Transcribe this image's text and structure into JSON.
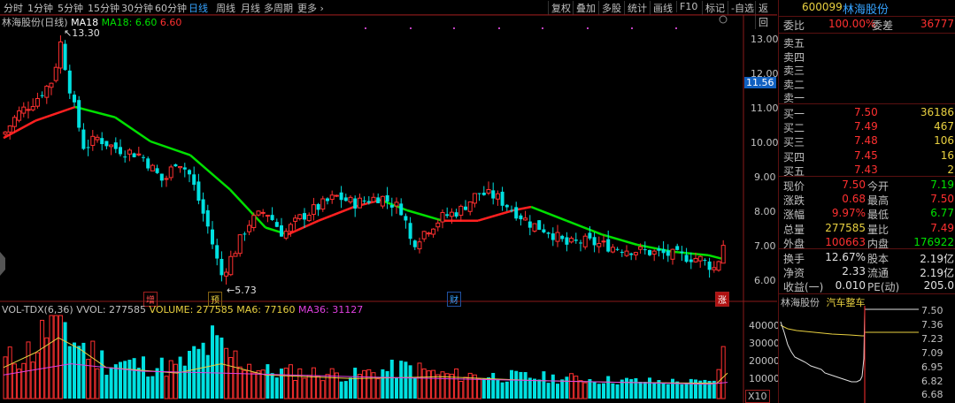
{
  "toolbar": {
    "periods": [
      "分时",
      "1分钟",
      "5分钟",
      "15分钟",
      "30分钟",
      "60分钟",
      "日线",
      "周线",
      "月线",
      "多周期",
      "更多"
    ],
    "active": "日线",
    "right": [
      "复权",
      "叠加",
      "多股",
      "统计",
      "画线",
      "F10",
      "标记",
      "-自选",
      "返回"
    ]
  },
  "chart_header": {
    "title": "林海股份(日线)",
    "ma": "MA18",
    "ma18_label": "MA18: 6.60",
    "ma18_value": "6.60"
  },
  "price_axis": [
    "13.00",
    "12.00",
    "11.00",
    "10.00",
    "9.00",
    "8.00",
    "7.00",
    "6.00"
  ],
  "current_price_tag": "11.56",
  "annotations": {
    "high": "13.30",
    "low": "5.73",
    "tag_zeng": "增",
    "tag_jiu": "预",
    "tag_cai": "财",
    "tag_zhang": "涨"
  },
  "volume_header": {
    "name": "VOL-TDX(6,36)",
    "vvol": "VVOL: 277585",
    "volume": "VOLUME: 277585",
    "ma6": "MA6: 77160",
    "ma36": "MA36: 31127"
  },
  "volume_axis": [
    "40000",
    "30000",
    "20000",
    "10000"
  ],
  "volume_unit": "X10",
  "quote": {
    "code": "600099",
    "name": "林海股份",
    "weibi_label": "委比",
    "weibi": "100.00%",
    "weicha_label": "委差",
    "weicha": "36777",
    "sell": [
      {
        "label": "卖五",
        "price": "",
        "vol": ""
      },
      {
        "label": "卖四",
        "price": "",
        "vol": ""
      },
      {
        "label": "卖三",
        "price": "",
        "vol": ""
      },
      {
        "label": "卖二",
        "price": "",
        "vol": ""
      },
      {
        "label": "卖一",
        "price": "",
        "vol": ""
      }
    ],
    "buy": [
      {
        "label": "买一",
        "price": "7.50",
        "vol": "36186"
      },
      {
        "label": "买二",
        "price": "7.49",
        "vol": "467"
      },
      {
        "label": "买三",
        "price": "7.48",
        "vol": "106"
      },
      {
        "label": "买四",
        "price": "7.45",
        "vol": "16"
      },
      {
        "label": "买五",
        "price": "7.43",
        "vol": "2"
      }
    ],
    "stats": [
      {
        "l1": "现价",
        "v1": "7.50",
        "c1": "red",
        "l2": "今开",
        "v2": "7.19",
        "c2": "grn"
      },
      {
        "l1": "涨跌",
        "v1": "0.68",
        "c1": "red",
        "l2": "最高",
        "v2": "7.50",
        "c2": "red"
      },
      {
        "l1": "涨幅",
        "v1": "9.97%",
        "c1": "red",
        "l2": "最低",
        "v2": "6.77",
        "c2": "grn"
      },
      {
        "l1": "总量",
        "v1": "277585",
        "c1": "yel",
        "l2": "量比",
        "v2": "7.49",
        "c2": "red"
      },
      {
        "l1": "外盘",
        "v1": "100663",
        "c1": "red",
        "l2": "内盘",
        "v2": "176922",
        "c2": "grn"
      }
    ],
    "stats2": [
      {
        "l1": "换手",
        "v1": "12.67%",
        "l2": "股本",
        "v2": "2.19亿"
      },
      {
        "l1": "净资",
        "v1": "2.33",
        "l2": "流通",
        "v2": "2.19亿"
      },
      {
        "l1": "收益(一)",
        "v1": "0.010",
        "l2": "PE(动)",
        "v2": "205.0"
      }
    ]
  },
  "mini": {
    "name": "林海股份",
    "sector": "汽车整车",
    "axis": [
      "7.50",
      "7.36",
      "7.23",
      "7.09",
      "6.95",
      "6.82",
      "6.68"
    ]
  },
  "colors": {
    "up": "#ff3030",
    "down": "#00e0e0",
    "ma_up": "#ff2020",
    "ma_down": "#00e000"
  }
}
